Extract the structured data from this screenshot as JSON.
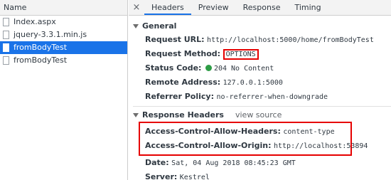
{
  "left": {
    "header": "Name",
    "requests": [
      {
        "name": "Index.aspx"
      },
      {
        "name": "jquery-3.3.1.min.js"
      },
      {
        "name": "fromBodyTest"
      },
      {
        "name": "fromBodyTest"
      }
    ]
  },
  "tabs": {
    "close": "×",
    "items": [
      "Headers",
      "Preview",
      "Response",
      "Timing"
    ]
  },
  "general": {
    "title": "General",
    "request_url_label": "Request URL:",
    "request_url": "http://localhost:5000/home/fromBodyTest",
    "request_method_label": "Request Method:",
    "request_method": "OPTIONS",
    "status_code_label": "Status Code:",
    "status_code": "204 No Content",
    "remote_address_label": "Remote Address:",
    "remote_address": "127.0.0.1:5000",
    "referrer_policy_label": "Referrer Policy:",
    "referrer_policy": "no-referrer-when-downgrade"
  },
  "response_headers": {
    "title": "Response Headers",
    "view_source": "view source",
    "acah_label": "Access-Control-Allow-Headers:",
    "acah": "content-type",
    "acao_label": "Access-Control-Allow-Origin:",
    "acao": "http://localhost:53894",
    "date_label": "Date:",
    "date": "Sat, 04 Aug 2018 08:45:23 GMT",
    "server_label": "Server:",
    "server": "Kestrel"
  },
  "colors": {
    "accent": "#1a73e8",
    "highlight": "#e60000",
    "status_ok": "#2e9d46"
  }
}
